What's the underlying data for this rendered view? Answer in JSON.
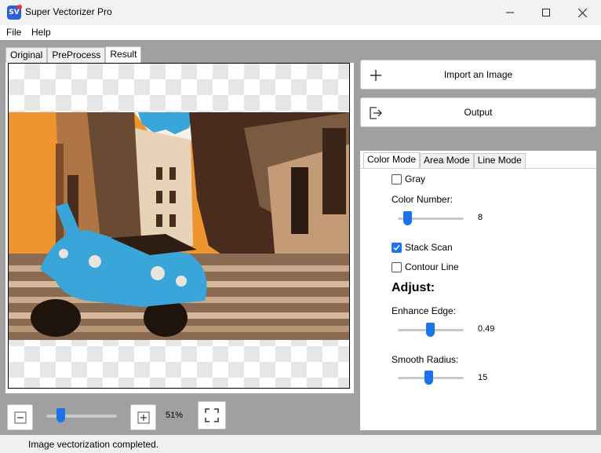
{
  "window": {
    "title": "Super Vectorizer Pro",
    "icon": "SV"
  },
  "menu": [
    "File",
    "Help"
  ],
  "view_tabs": [
    "Original",
    "PreProcess",
    "Result"
  ],
  "active_view_tab": "Result",
  "zoom": {
    "level": "51%",
    "slider_fraction": 0.2
  },
  "actions": {
    "import_label": "Import an Image",
    "output_label": "Output"
  },
  "mode_tabs": [
    "Color Mode",
    "Area Mode",
    "Line Mode"
  ],
  "active_mode_tab": "Color Mode",
  "settings": {
    "gray": {
      "label": "Gray",
      "checked": false
    },
    "color_number": {
      "label": "Color Number:",
      "value": "8",
      "fraction": 0.14
    },
    "stack_scan": {
      "label": "Stack Scan",
      "checked": true
    },
    "contour_line": {
      "label": "Contour Line",
      "checked": false
    },
    "adjust_heading": "Adjust:",
    "enhance_edge": {
      "label": "Enhance Edge:",
      "value": "0.49",
      "fraction": 0.49
    },
    "smooth_radius": {
      "label": "Smooth Radius:",
      "value": "15",
      "fraction": 0.47
    }
  },
  "status": "Image vectorization completed.",
  "colors": {
    "accent": "#1a73e8",
    "workspace": "#a0a0a0",
    "orange": "#ef9530",
    "scooter_blue": "#3aa5d8"
  }
}
